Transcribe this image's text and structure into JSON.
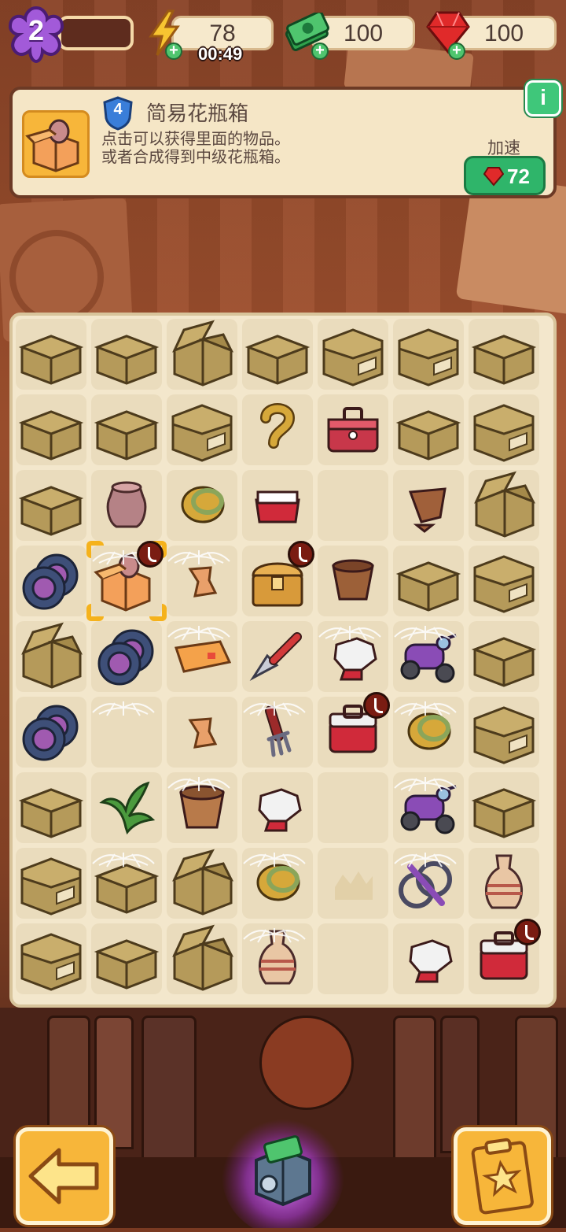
{
  "header": {
    "level": "2",
    "energy": {
      "value": "78",
      "timer": "00:49",
      "icon": "lightning-icon"
    },
    "cash": {
      "value": "100",
      "icon": "cash-stack-icon"
    },
    "gems": {
      "value": "100",
      "icon": "ruby-icon"
    }
  },
  "info_panel": {
    "item_level": "4",
    "title": "简易花瓶箱",
    "desc_line1": "点击可以获得里面的物品。",
    "desc_line2": "或者合成得到中级花瓶箱。",
    "speed_label": "加速",
    "speed_cost": "72",
    "help_icon": "info-icon"
  },
  "board": {
    "columns": 7,
    "rows": 9,
    "cells": [
      [
        "box",
        "box",
        "box-open",
        "box",
        "box-label",
        "box-label",
        "box"
      ],
      [
        "box",
        "box",
        "box-label",
        "rope",
        "toolbox",
        "box",
        "box-label"
      ],
      [
        "box",
        "jar",
        "lasso",
        "red-tray",
        "empty",
        "broken-pot",
        "box-open"
      ],
      [
        "tires",
        "vase-crate",
        "shard",
        "chest",
        "clay-pot",
        "box",
        "box-label"
      ],
      [
        "box-open",
        "tires",
        "cloth",
        "trowel",
        "glove",
        "scooter",
        "box"
      ],
      [
        "tires",
        "empty",
        "shard",
        "rake",
        "toolbox-red",
        "lasso",
        "box-label"
      ],
      [
        "box",
        "plant",
        "flower-pot",
        "glove",
        "empty",
        "scooter",
        "box"
      ],
      [
        "box-label",
        "box",
        "box-open",
        "lasso",
        "empty-leaf",
        "bicycle",
        "vase"
      ],
      [
        "box-label",
        "box",
        "box-open",
        "vase",
        "empty",
        "glove",
        "toolbox-red"
      ]
    ],
    "webbed": [
      [
        3,
        1
      ],
      [
        3,
        2
      ],
      [
        4,
        2
      ],
      [
        4,
        4
      ],
      [
        4,
        5
      ],
      [
        5,
        1
      ],
      [
        5,
        3
      ],
      [
        5,
        5
      ],
      [
        6,
        2
      ],
      [
        6,
        5
      ],
      [
        7,
        1
      ],
      [
        7,
        3
      ],
      [
        7,
        5
      ],
      [
        8,
        3
      ]
    ],
    "selected": [
      3,
      1
    ],
    "timed": [
      [
        3,
        1
      ],
      [
        3,
        3
      ],
      [
        5,
        4
      ],
      [
        8,
        6
      ]
    ]
  },
  "footer": {
    "back_icon": "arrow-left-icon",
    "bank_icon": "cash-safe-icon",
    "quest_icon": "quest-clipboard-icon"
  },
  "colors": {
    "accent_green": "#2fb56a",
    "gold": "#f7b63a",
    "panel": "#f5e6c6",
    "purple_level": "#a25ad9"
  }
}
